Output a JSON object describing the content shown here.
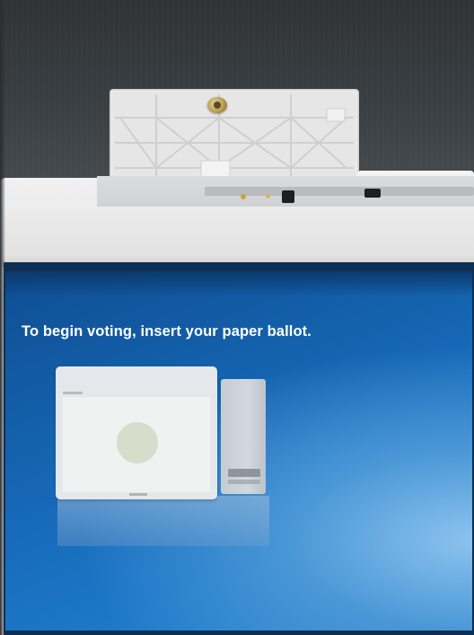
{
  "screen": {
    "prompt": "To begin voting, insert your paper ballot.",
    "background_color": "#1767b5",
    "text_color": "#ffffff"
  },
  "illustration": {
    "depicts": "ballot marking device screen beside ballot scanner",
    "screen_color": "#e4e8ec",
    "scanner_color": "#c9d0d6"
  },
  "hardware": {
    "lid_color": "#e6e6e6",
    "housing_color": "#ececec",
    "wall_color": "#34393d"
  }
}
